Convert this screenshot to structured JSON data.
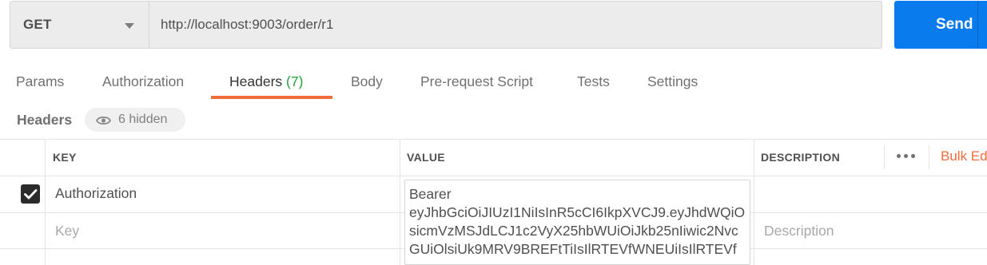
{
  "request": {
    "method": "GET",
    "url": "http://localhost:9003/order/r1",
    "send_label": "Send"
  },
  "tabs": {
    "params": "Params",
    "authorization": "Authorization",
    "headers": "Headers",
    "headers_count": "(7)",
    "body": "Body",
    "pre_request_script": "Pre-request Script",
    "tests": "Tests",
    "settings": "Settings"
  },
  "subbar": {
    "title": "Headers",
    "hidden_label": "6 hidden"
  },
  "table": {
    "columns": {
      "key": "KEY",
      "value": "VALUE",
      "description": "DESCRIPTION"
    },
    "bulk_edit_label": "Bulk Ed",
    "rows": [
      {
        "checked": true,
        "key": "Authorization",
        "value_lines": [
          "Bearer",
          "eyJhbGciOiJIUzI1NiIsInR5cCI6IkpXVCJ9.eyJhdWQiOl",
          "sicmVzMSJdLCJ1c2VyX25hbWUiOiJkb25nIiwic2Nvc",
          "GUiOlsiUk9MRV9BREFtTiIsIlRTEVfWNEUiIsIlRTEVf"
        ]
      }
    ],
    "new_row": {
      "key_placeholder": "Key",
      "description_placeholder": "Description"
    }
  },
  "colors": {
    "accent": "#f26b3a",
    "send": "#097bed",
    "count": "#26a141"
  }
}
